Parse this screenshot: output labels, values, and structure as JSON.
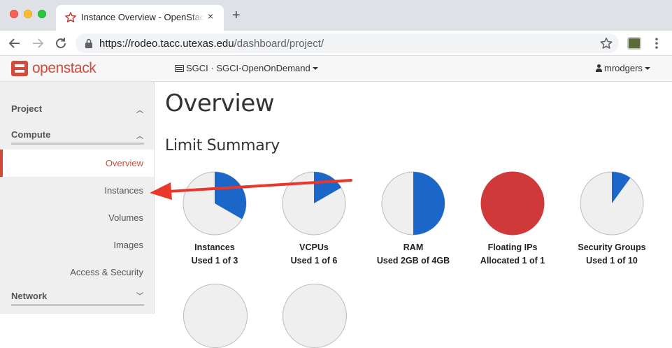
{
  "browser": {
    "tab_title": "Instance Overview - OpenStack Dashboard",
    "tab_close": "×",
    "new_tab": "+",
    "url_host": "https://rodeo.tacc.utexas.edu",
    "url_path": "/dashboard/project/"
  },
  "topbar": {
    "brand": "openstack",
    "project_selector": "SGCI · SGCI-OpenOnDemand",
    "user": "mrodgers",
    "brand_color": "#d44a3a"
  },
  "sidebar": {
    "project_label": "Project",
    "compute_label": "Compute",
    "network_label": "Network",
    "items": [
      {
        "label": "Overview",
        "active": true
      },
      {
        "label": "Instances",
        "active": false
      },
      {
        "label": "Volumes",
        "active": false
      },
      {
        "label": "Images",
        "active": false
      },
      {
        "label": "Access & Security",
        "active": false
      }
    ]
  },
  "main": {
    "title": "Overview",
    "limit_summary_title": "Limit Summary",
    "colors": {
      "used": "#1b66c9",
      "full": "#d0393a",
      "empty": "#efefef",
      "border": "#bbbbbb",
      "annotation_arrow": "#e8382b"
    },
    "limits": [
      {
        "name": "Instances",
        "usage_text": "Used 1 of 3",
        "fraction": 0.3333
      },
      {
        "name": "VCPUs",
        "usage_text": "Used 1 of 6",
        "fraction": 0.1667
      },
      {
        "name": "RAM",
        "usage_text": "Used 2GB of 4GB",
        "fraction": 0.5
      },
      {
        "name": "Floating IPs",
        "usage_text": "Allocated 1 of 1",
        "fraction": 1.0
      },
      {
        "name": "Security Groups",
        "usage_text": "Used 1 of 10",
        "fraction": 0.1
      }
    ],
    "partial_second_row_charts": 2
  }
}
